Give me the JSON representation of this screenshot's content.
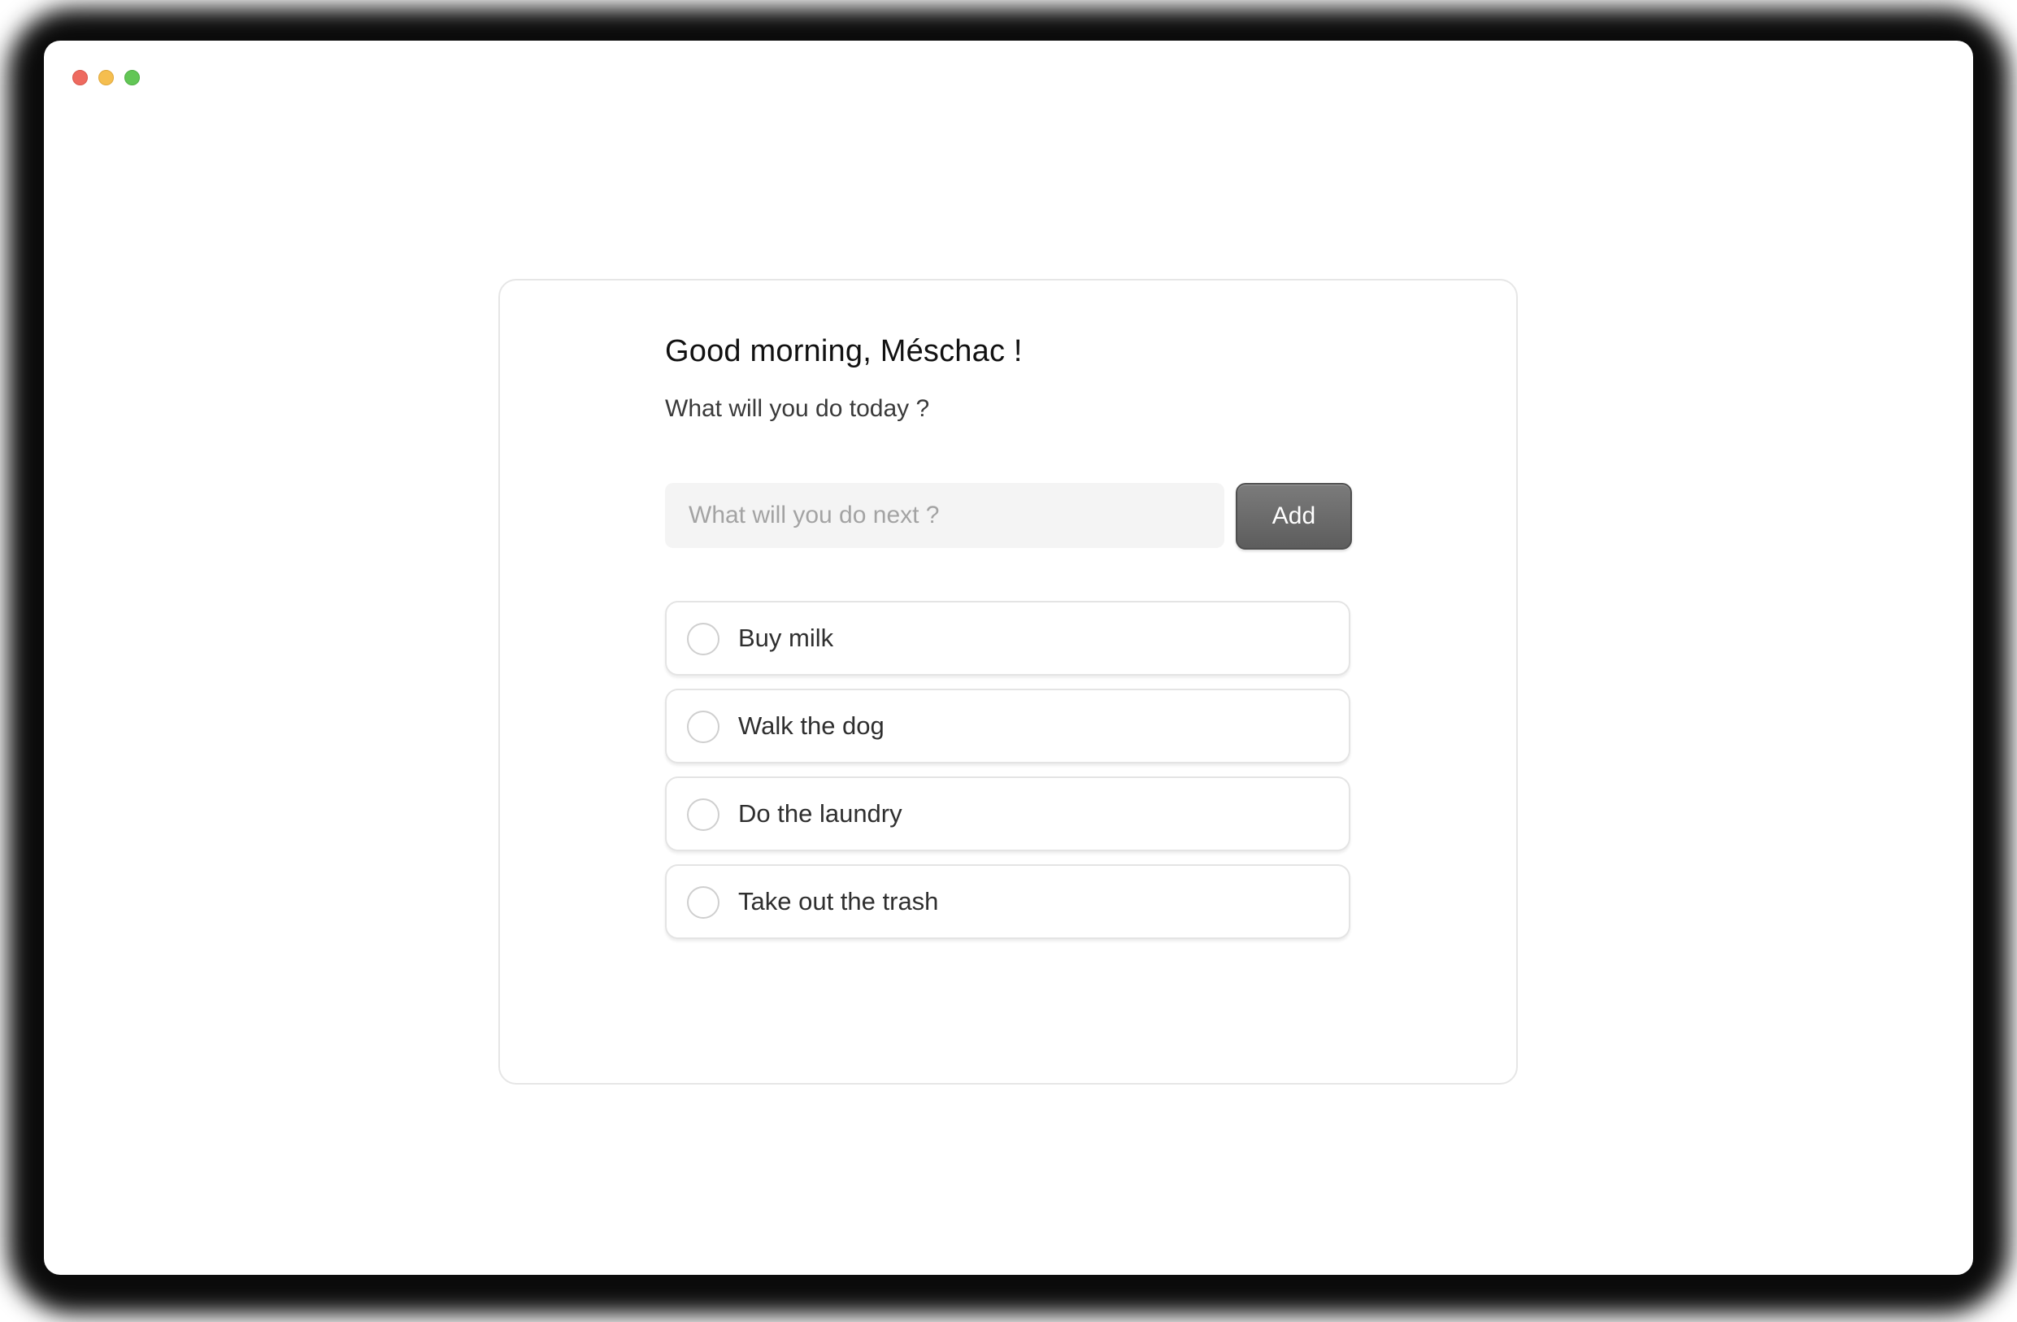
{
  "window": {
    "controls": [
      "close",
      "minimize",
      "zoom"
    ]
  },
  "header": {
    "greeting": "Good morning, Méschac !",
    "subtitle": "What will you do today ?"
  },
  "new_task": {
    "value": "",
    "placeholder": "What will you do next ?",
    "add_label": "Add"
  },
  "todos": [
    {
      "label": "Buy milk",
      "done": false
    },
    {
      "label": "Walk the dog",
      "done": false
    },
    {
      "label": "Do the laundry",
      "done": false
    },
    {
      "label": "Take out the trash",
      "done": false
    }
  ]
}
